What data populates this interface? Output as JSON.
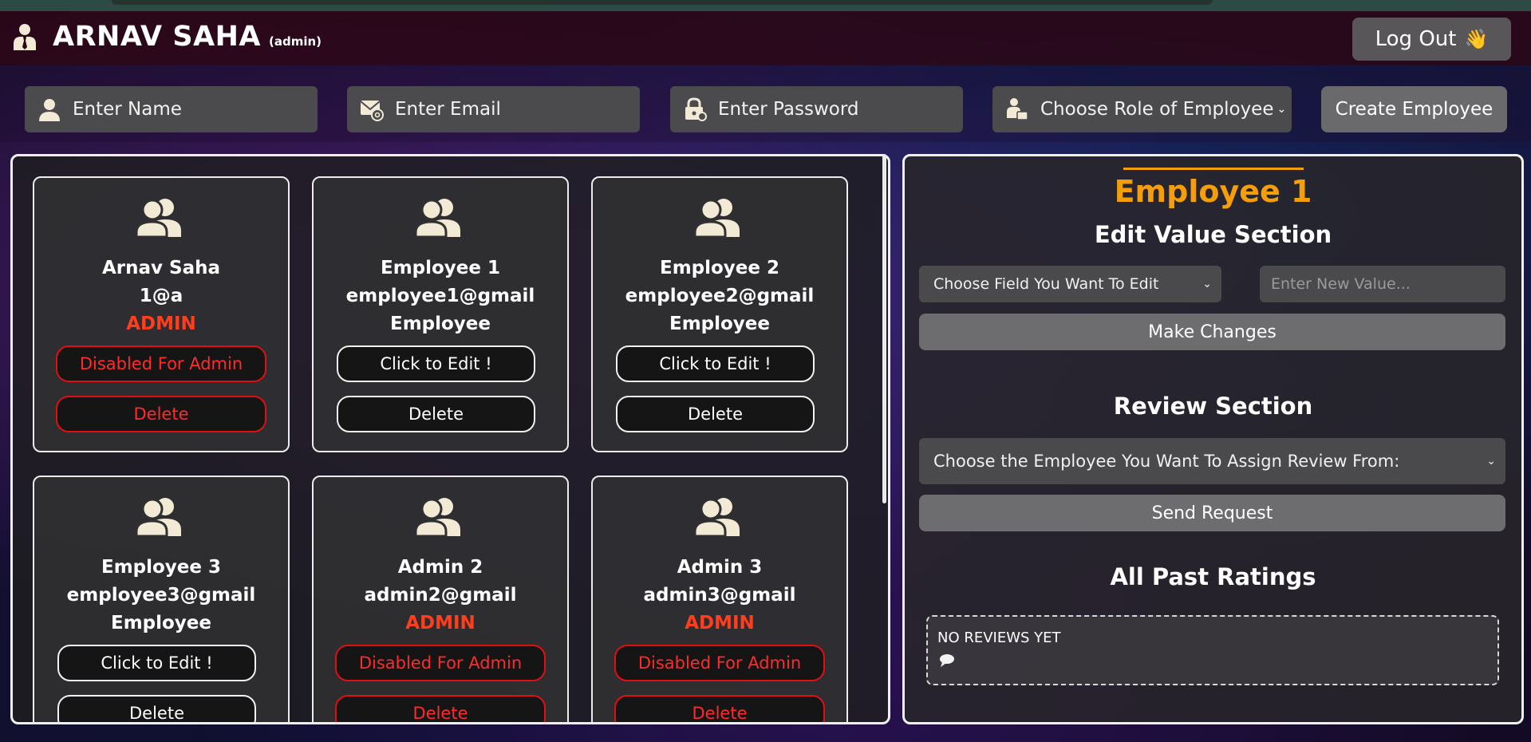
{
  "header": {
    "user_name": "ARNAV SAHA",
    "user_role": "(admin)",
    "logout_label": "Log Out",
    "logout_emoji": "👋"
  },
  "create_form": {
    "name_placeholder": "Enter Name",
    "email_placeholder": "Enter Email",
    "password_placeholder": "Enter Password",
    "role_select": "Choose Role of Employee",
    "create_label": "Create Employee"
  },
  "employees": [
    {
      "name": "Arnav Saha",
      "email": "1@a",
      "role": "ADMIN",
      "edit_label": "Disabled For Admin",
      "delete_label": "Delete",
      "is_admin": true
    },
    {
      "name": "Employee 1",
      "email": "employee1@gmail",
      "role": "Employee",
      "edit_label": "Click to Edit !",
      "delete_label": "Delete",
      "is_admin": false
    },
    {
      "name": "Employee 2",
      "email": "employee2@gmail",
      "role": "Employee",
      "edit_label": "Click to Edit !",
      "delete_label": "Delete",
      "is_admin": false
    },
    {
      "name": "Employee 3",
      "email": "employee3@gmail",
      "role": "Employee",
      "edit_label": "Click to Edit !",
      "delete_label": "Delete",
      "is_admin": false
    },
    {
      "name": "Admin 2",
      "email": "admin2@gmail",
      "role": "ADMIN",
      "edit_label": "Disabled For Admin",
      "delete_label": "Delete",
      "is_admin": true
    },
    {
      "name": "Admin 3",
      "email": "admin3@gmail",
      "role": "ADMIN",
      "edit_label": "Disabled For Admin",
      "delete_label": "Delete",
      "is_admin": true
    }
  ],
  "detail": {
    "selected_employee": "Employee 1",
    "edit_heading": "Edit Value Section",
    "field_select": "Choose Field You Want To Edit",
    "new_value_placeholder": "Enter New Value...",
    "make_changes_label": "Make Changes",
    "review_heading": "Review Section",
    "reviewer_select": "Choose the Employee You Want To Assign Review From:",
    "send_request_label": "Send Request",
    "ratings_heading": "All Past Ratings",
    "no_reviews_text": "NO REVIEWS YET"
  },
  "colors": {
    "accent_orange": "#f59e0b",
    "admin_red": "#ff3e1c",
    "disabled_red": "#e01010"
  }
}
